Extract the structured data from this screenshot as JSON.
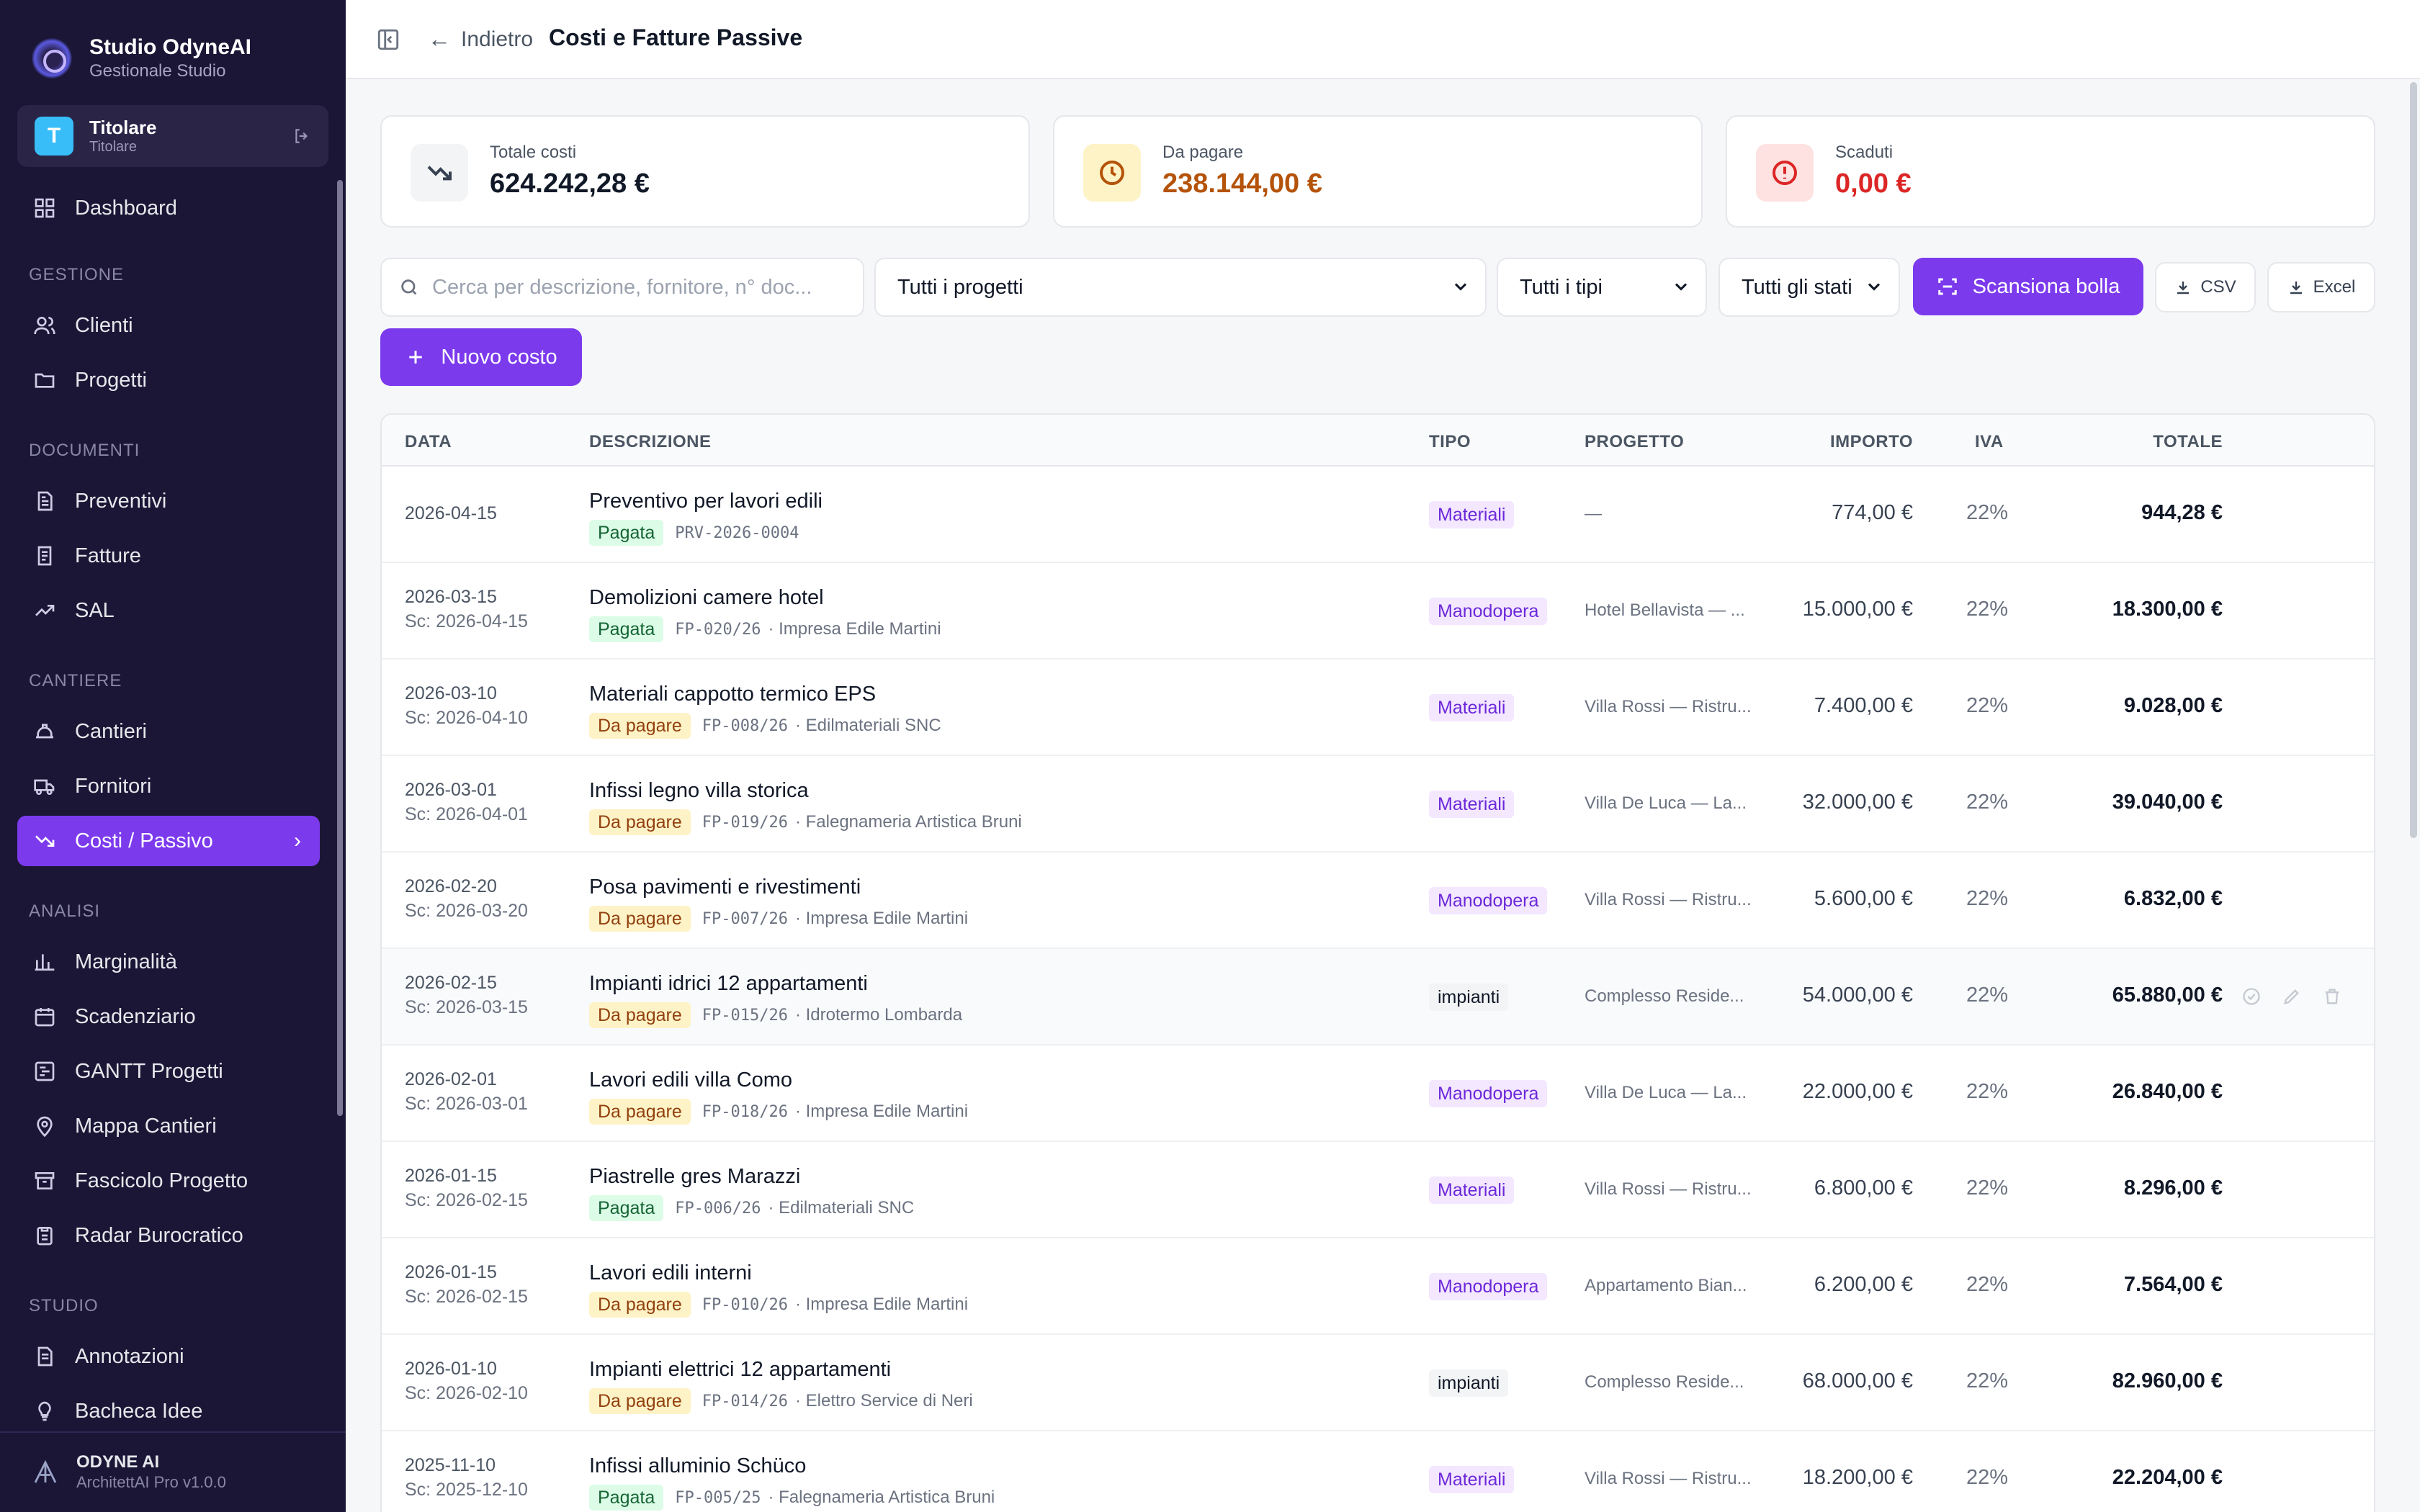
{
  "brand": {
    "title": "Studio OdyneAI",
    "subtitle": "Gestionale Studio"
  },
  "user": {
    "initial": "T",
    "name": "Titolare",
    "role": "Titolare"
  },
  "nav": {
    "dashboard": "Dashboard",
    "sections": {
      "gestione": "GESTIONE",
      "documenti": "DOCUMENTI",
      "cantiere": "CANTIERE",
      "analisi": "ANALISI",
      "studio": "STUDIO"
    },
    "clienti": "Clienti",
    "progetti": "Progetti",
    "preventivi": "Preventivi",
    "fatture": "Fatture",
    "sal": "SAL",
    "cantieri": "Cantieri",
    "fornitori": "Fornitori",
    "costi": "Costi / Passivo",
    "marginalita": "Marginalità",
    "scadenziario": "Scadenziario",
    "gantt": "GANTT Progetti",
    "mappa": "Mappa Cantieri",
    "fascicolo": "Fascicolo Progetto",
    "radar": "Radar Burocratico",
    "annotazioni": "Annotazioni",
    "bacheca": "Bacheca Idee"
  },
  "footer": {
    "title": "ODYNE AI",
    "subtitle": "ArchitettAI Pro v1.0.0"
  },
  "topbar": {
    "back": "Indietro",
    "title": "Costi e Fatture Passive"
  },
  "stats": {
    "totale": {
      "label": "Totale costi",
      "value": "624.242,28 €"
    },
    "dapagare": {
      "label": "Da pagare",
      "value": "238.144,00 €"
    },
    "scaduti": {
      "label": "Scaduti",
      "value": "0,00 €"
    }
  },
  "filters": {
    "search_placeholder": "Cerca per descrizione, fornitore, n° doc...",
    "project": "Tutti i progetti",
    "type": "Tutti i tipi",
    "status": "Tutti gli stati",
    "scan": "Scansiona bolla",
    "csv": "CSV",
    "excel": "Excel",
    "new": "Nuovo costo"
  },
  "colors": {
    "accent": "#7c3aed",
    "sidebar": "#1b1636",
    "warning": "#b45309",
    "danger": "#dc2626"
  },
  "table": {
    "headers": {
      "date": "DATA",
      "desc": "DESCRIZIONE",
      "type": "TIPO",
      "project": "PROGETTO",
      "amount": "IMPORTO",
      "iva": "IVA",
      "total": "TOTALE"
    },
    "rows": [
      {
        "date": "2026-04-15",
        "due": "",
        "title": "Preventivo per lavori edili",
        "status": "Pagata",
        "doc": "PRV-2026-0004",
        "supplier": "",
        "type": "Materiali",
        "project": "—",
        "amount": "774,00 €",
        "iva": "22%",
        "total": "944,28 €"
      },
      {
        "date": "2026-03-15",
        "due": "Sc: 2026-04-15",
        "title": "Demolizioni camere hotel",
        "status": "Pagata",
        "doc": "FP-020/26",
        "supplier": "· Impresa Edile Martini",
        "type": "Manodopera",
        "project": "Hotel Bellavista — ...",
        "amount": "15.000,00 €",
        "iva": "22%",
        "total": "18.300,00 €"
      },
      {
        "date": "2026-03-10",
        "due": "Sc: 2026-04-10",
        "title": "Materiali cappotto termico EPS",
        "status": "Da pagare",
        "doc": "FP-008/26",
        "supplier": "· Edilmateriali SNC",
        "type": "Materiali",
        "project": "Villa Rossi — Ristru...",
        "amount": "7.400,00 €",
        "iva": "22%",
        "total": "9.028,00 €"
      },
      {
        "date": "2026-03-01",
        "due": "Sc: 2026-04-01",
        "title": "Infissi legno villa storica",
        "status": "Da pagare",
        "doc": "FP-019/26",
        "supplier": "· Falegnameria Artistica Bruni",
        "type": "Materiali",
        "project": "Villa De Luca — La...",
        "amount": "32.000,00 €",
        "iva": "22%",
        "total": "39.040,00 €"
      },
      {
        "date": "2026-02-20",
        "due": "Sc: 2026-03-20",
        "title": "Posa pavimenti e rivestimenti",
        "status": "Da pagare",
        "doc": "FP-007/26",
        "supplier": "· Impresa Edile Martini",
        "type": "Manodopera",
        "project": "Villa Rossi — Ristru...",
        "amount": "5.600,00 €",
        "iva": "22%",
        "total": "6.832,00 €"
      },
      {
        "date": "2026-02-15",
        "due": "Sc: 2026-03-15",
        "title": "Impianti idrici 12 appartamenti",
        "status": "Da pagare",
        "doc": "FP-015/26",
        "supplier": "· Idrotermo Lombarda",
        "type": "impianti",
        "project": "Complesso Reside...",
        "amount": "54.000,00 €",
        "iva": "22%",
        "total": "65.880,00 €"
      },
      {
        "date": "2026-02-01",
        "due": "Sc: 2026-03-01",
        "title": "Lavori edili villa Como",
        "status": "Da pagare",
        "doc": "FP-018/26",
        "supplier": "· Impresa Edile Martini",
        "type": "Manodopera",
        "project": "Villa De Luca — La...",
        "amount": "22.000,00 €",
        "iva": "22%",
        "total": "26.840,00 €"
      },
      {
        "date": "2026-01-15",
        "due": "Sc: 2026-02-15",
        "title": "Piastrelle gres Marazzi",
        "status": "Pagata",
        "doc": "FP-006/26",
        "supplier": "· Edilmateriali SNC",
        "type": "Materiali",
        "project": "Villa Rossi — Ristru...",
        "amount": "6.800,00 €",
        "iva": "22%",
        "total": "8.296,00 €"
      },
      {
        "date": "2026-01-15",
        "due": "Sc: 2026-02-15",
        "title": "Lavori edili interni",
        "status": "Da pagare",
        "doc": "FP-010/26",
        "supplier": "· Impresa Edile Martini",
        "type": "Manodopera",
        "project": "Appartamento Bian...",
        "amount": "6.200,00 €",
        "iva": "22%",
        "total": "7.564,00 €"
      },
      {
        "date": "2026-01-10",
        "due": "Sc: 2026-02-10",
        "title": "Impianti elettrici 12 appartamenti",
        "status": "Da pagare",
        "doc": "FP-014/26",
        "supplier": "· Elettro Service di Neri",
        "type": "impianti",
        "project": "Complesso Reside...",
        "amount": "68.000,00 €",
        "iva": "22%",
        "total": "82.960,00 €"
      },
      {
        "date": "2025-11-10",
        "due": "Sc: 2025-12-10",
        "title": "Infissi alluminio Schüco",
        "status": "Pagata",
        "doc": "FP-005/25",
        "supplier": "· Falegnameria Artistica Bruni",
        "type": "Materiali",
        "project": "Villa Rossi — Ristru...",
        "amount": "18.200,00 €",
        "iva": "22%",
        "total": "22.204,00 €"
      }
    ]
  }
}
